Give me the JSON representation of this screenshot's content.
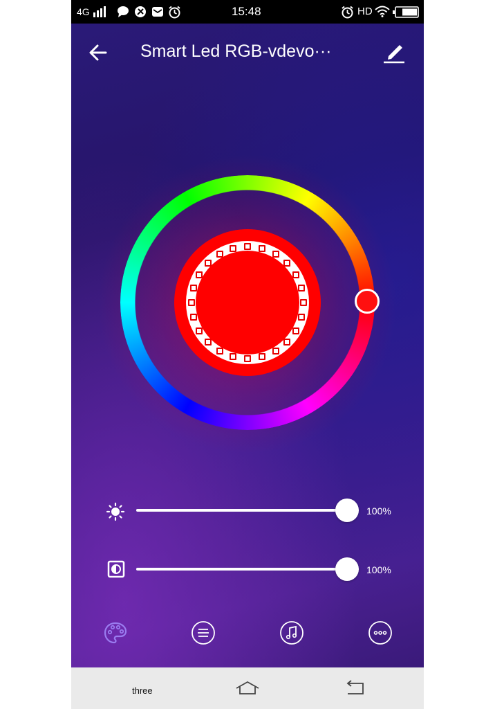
{
  "status_bar": {
    "network": "4G",
    "time": "15:48",
    "hd": "HD"
  },
  "header": {
    "title": "Smart Led RGB-vdevo···"
  },
  "color": {
    "selected_hex": "#ff0000"
  },
  "sliders": {
    "brightness": {
      "value": 1.0,
      "label": "100%"
    },
    "saturation": {
      "value": 1.0,
      "label": "100%"
    }
  },
  "bottom_nav": {
    "items": [
      "palette-icon",
      "list-icon",
      "music-icon",
      "more-icon"
    ],
    "active_color": "#9a7cf0"
  },
  "system_nav": {
    "label": "three"
  }
}
